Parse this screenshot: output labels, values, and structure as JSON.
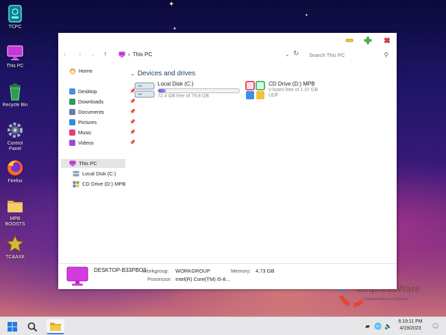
{
  "desktop": {
    "icons": [
      {
        "label": "TCPC",
        "icon": "tcpc-icon"
      },
      {
        "label": "This PC",
        "icon": "monitor-icon"
      },
      {
        "label": "Recycle Bin",
        "icon": "recycle-bin-icon"
      },
      {
        "label": "Control Panel",
        "icon": "gear-icon"
      },
      {
        "label": "Firefox",
        "icon": "firefox-icon"
      },
      {
        "label": "MPB BOOSTS",
        "icon": "folder-icon"
      },
      {
        "label": "TC&AXE",
        "icon": "star-icon"
      }
    ]
  },
  "explorer": {
    "breadcrumb": "This PC",
    "search_placeholder": "Search This PC",
    "sidebar": {
      "home": "Home",
      "quick": [
        {
          "label": "Desktop",
          "color": "#4a8fe0"
        },
        {
          "label": "Downloads",
          "color": "#2e9e58"
        },
        {
          "label": "Documents",
          "color": "#6b7fa6"
        },
        {
          "label": "Pictures",
          "color": "#2f8fd8"
        },
        {
          "label": "Music",
          "color": "#e0407a"
        },
        {
          "label": "Videos",
          "color": "#9c4ad8"
        }
      ],
      "this_pc": "This PC",
      "drives": [
        "Local Disk (C:)",
        "CD Drive (D:) MPB"
      ]
    },
    "group_title": "Devices and drives",
    "drives": [
      {
        "name": "Local Disk (C:)",
        "free": "72.4 GB free of 79.8 GB",
        "used_fraction": 0.09
      },
      {
        "name": "CD Drive (D:) MPB",
        "free": "0 bytes free of 1.37 GB",
        "fs": "UDF"
      }
    ],
    "details": {
      "pc_name": "DESKTOP-B33PBO3",
      "workgroup_label": "Workgroup:",
      "workgroup": "WORKGROUP",
      "memory_label": "Memory:",
      "memory": "4.73 GB",
      "processor_label": "Processor:",
      "processor": "Intel(R) Core(TM) i5-8..."
    }
  },
  "taskbar": {
    "time": "6:19:11 PM",
    "date": "4/19/2023"
  },
  "watermark": {
    "text": "ompressWare",
    "tagline": "Troubleshooting and Solutions"
  },
  "colors": {
    "accent": "#3b7ddd",
    "minimize": "#f2c12e",
    "maximize": "#3dbb3d",
    "close": "#e63946"
  }
}
